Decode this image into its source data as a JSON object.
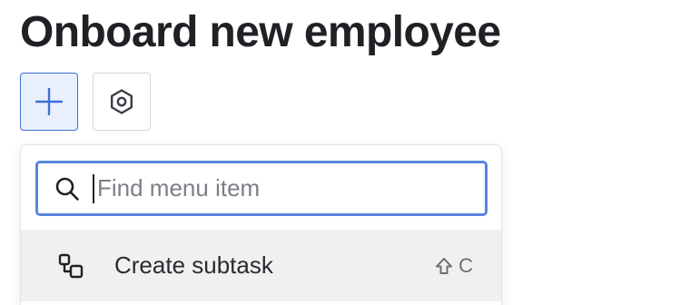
{
  "page": {
    "title": "Onboard new employee"
  },
  "toolbar": {
    "add_icon": "plus-icon",
    "settings_icon": "hexagon-gear-icon"
  },
  "menu": {
    "search": {
      "placeholder": "Find menu item",
      "value": "",
      "icon": "search-icon"
    },
    "items": [
      {
        "label": "Create subtask",
        "icon": "subtask-icon",
        "shortcut_modifier": "shift-icon",
        "shortcut_key": "C"
      }
    ]
  },
  "colors": {
    "accent": "#3e6fd6",
    "focus_ring": "#5b84de",
    "hover_row": "#f0f0f1",
    "title_text": "#1f2125"
  }
}
